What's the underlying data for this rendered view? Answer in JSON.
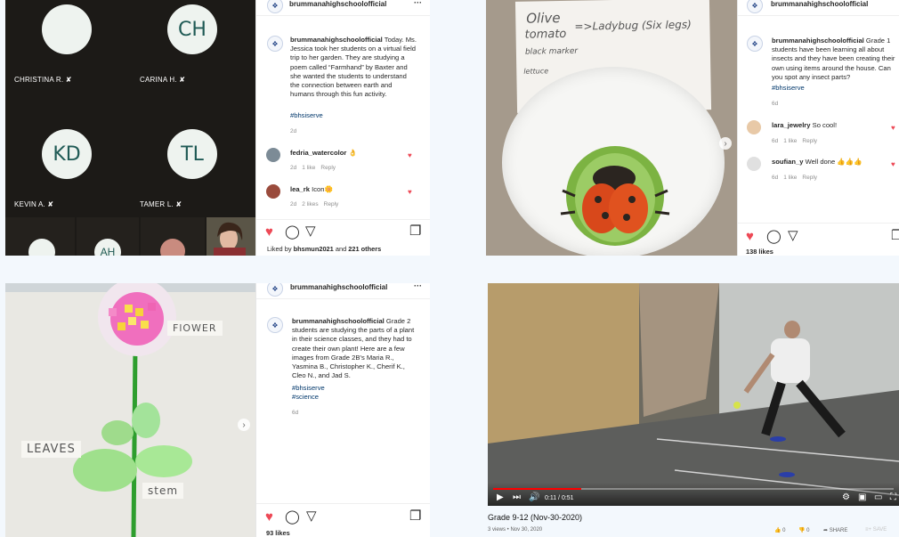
{
  "call": {
    "participants": [
      {
        "initials": "",
        "name": "CHRISTINA R."
      },
      {
        "initials": "CH",
        "name": "CARINA H."
      },
      {
        "initials": "KD",
        "name": "KEVIN A."
      },
      {
        "initials": "TL",
        "name": "TAMER L."
      }
    ],
    "strip_initials": "AH",
    "muted_symbol": "†"
  },
  "post1": {
    "username": "brummanahighschoolofficial",
    "more": "···",
    "caption": "Today. Ms. Jessica took her students on a virtual field trip to her garden. They are studying a poem called “Farmhand” by Baxter and she wanted the students to understand the connection between earth and humans through this fun activity.",
    "hashtag": "#bhsiserve",
    "time": "2d",
    "comments": [
      {
        "user": "fedria_watercolor",
        "text": "👌",
        "time": "2d",
        "likes": "1 like",
        "reply": "Reply"
      },
      {
        "user": "lea_rk",
        "text": "Icon🌼",
        "time": "2d",
        "likes": "2 likes",
        "reply": "Reply"
      }
    ],
    "liked_by_prefix": "Liked by",
    "liked_by_user": "bhsmun2021",
    "liked_by_and": "and",
    "liked_by_others": "221 others"
  },
  "post2": {
    "username": "brummanahighschoolofficial",
    "caption": "Grade 1 students have been learning all about insects and they have been creating their own using items around the house. Can you spot any insect parts?",
    "hashtag": "#bhsiserve",
    "time": "6d",
    "comments": [
      {
        "user": "lara_jewelry",
        "text": "So cool!",
        "time": "6d",
        "likes": "1 like",
        "reply": "Reply"
      },
      {
        "user": "soufian_y",
        "text": "Well done 👍👍👍",
        "time": "6d",
        "likes": "1 like",
        "reply": "Reply"
      }
    ],
    "likes": "138 likes",
    "paper_lines": [
      "Olive",
      "tomato",
      "black marker",
      "lettuce"
    ],
    "paper_note": "=>Ladybug (Six legs)"
  },
  "post3": {
    "username": "brummanahighschoolofficial",
    "more": "···",
    "caption": "Grade 2 students are studying the parts of a plant in their science classes, and they had to create their own plant! Here are a few images from Grade 2B’s Maria R., Yasmina B., Christopher K., Cherif K., Cleo N., and Jad S.",
    "hashtags": [
      "#bhsiserve",
      "#science"
    ],
    "time": "6d",
    "likes": "93 likes",
    "craft_labels": {
      "flower": "FlOWER",
      "leaves": "LEAVES",
      "stem": "stem"
    }
  },
  "video": {
    "time_current": "0:11",
    "time_total": "0:51",
    "title": "Grade 9-12 (Nov-30-2020)",
    "meta": "3 views • Nov 30, 2020",
    "like_count": "0",
    "dislike_count": "0",
    "share": "SHARE",
    "save": "SAVE",
    "progress": 0.22
  },
  "colors": {
    "accent_red": "#ed4956",
    "link_blue": "#00376b",
    "yt_red": "#ff0000"
  }
}
